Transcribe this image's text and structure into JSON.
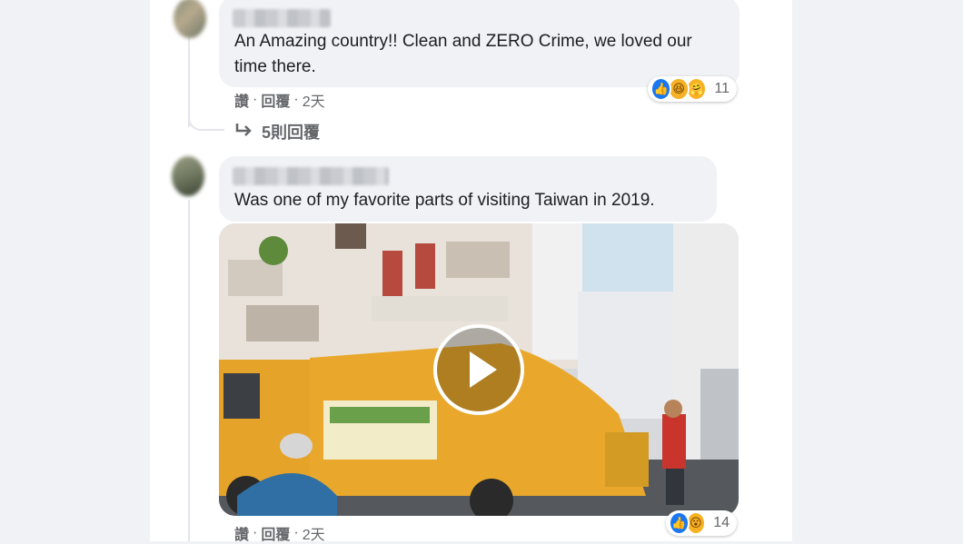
{
  "comments": [
    {
      "text": "An Amazing country!! Clean and ZERO Crime, we loved our time there.",
      "actions": {
        "like": "讚",
        "reply": "回覆",
        "time": "2天",
        "dot": "·"
      },
      "reactions": {
        "icons": [
          "like-icon",
          "haha-icon",
          "care-icon"
        ],
        "count": "11"
      },
      "replies_label": "5則回覆"
    },
    {
      "text": "Was one of my favorite parts of visiting Taiwan in 2019.",
      "actions": {
        "like": "讚",
        "reply": "回覆",
        "time": "2天",
        "dot": "·"
      },
      "reactions": {
        "icons": [
          "like-icon",
          "wow-icon"
        ],
        "count": "14"
      },
      "media": {
        "type": "video",
        "play_icon": "play-icon"
      }
    }
  ],
  "colors": {
    "accent": "#1877f2",
    "bubble": "#f0f2f5",
    "meta": "#65676b"
  }
}
